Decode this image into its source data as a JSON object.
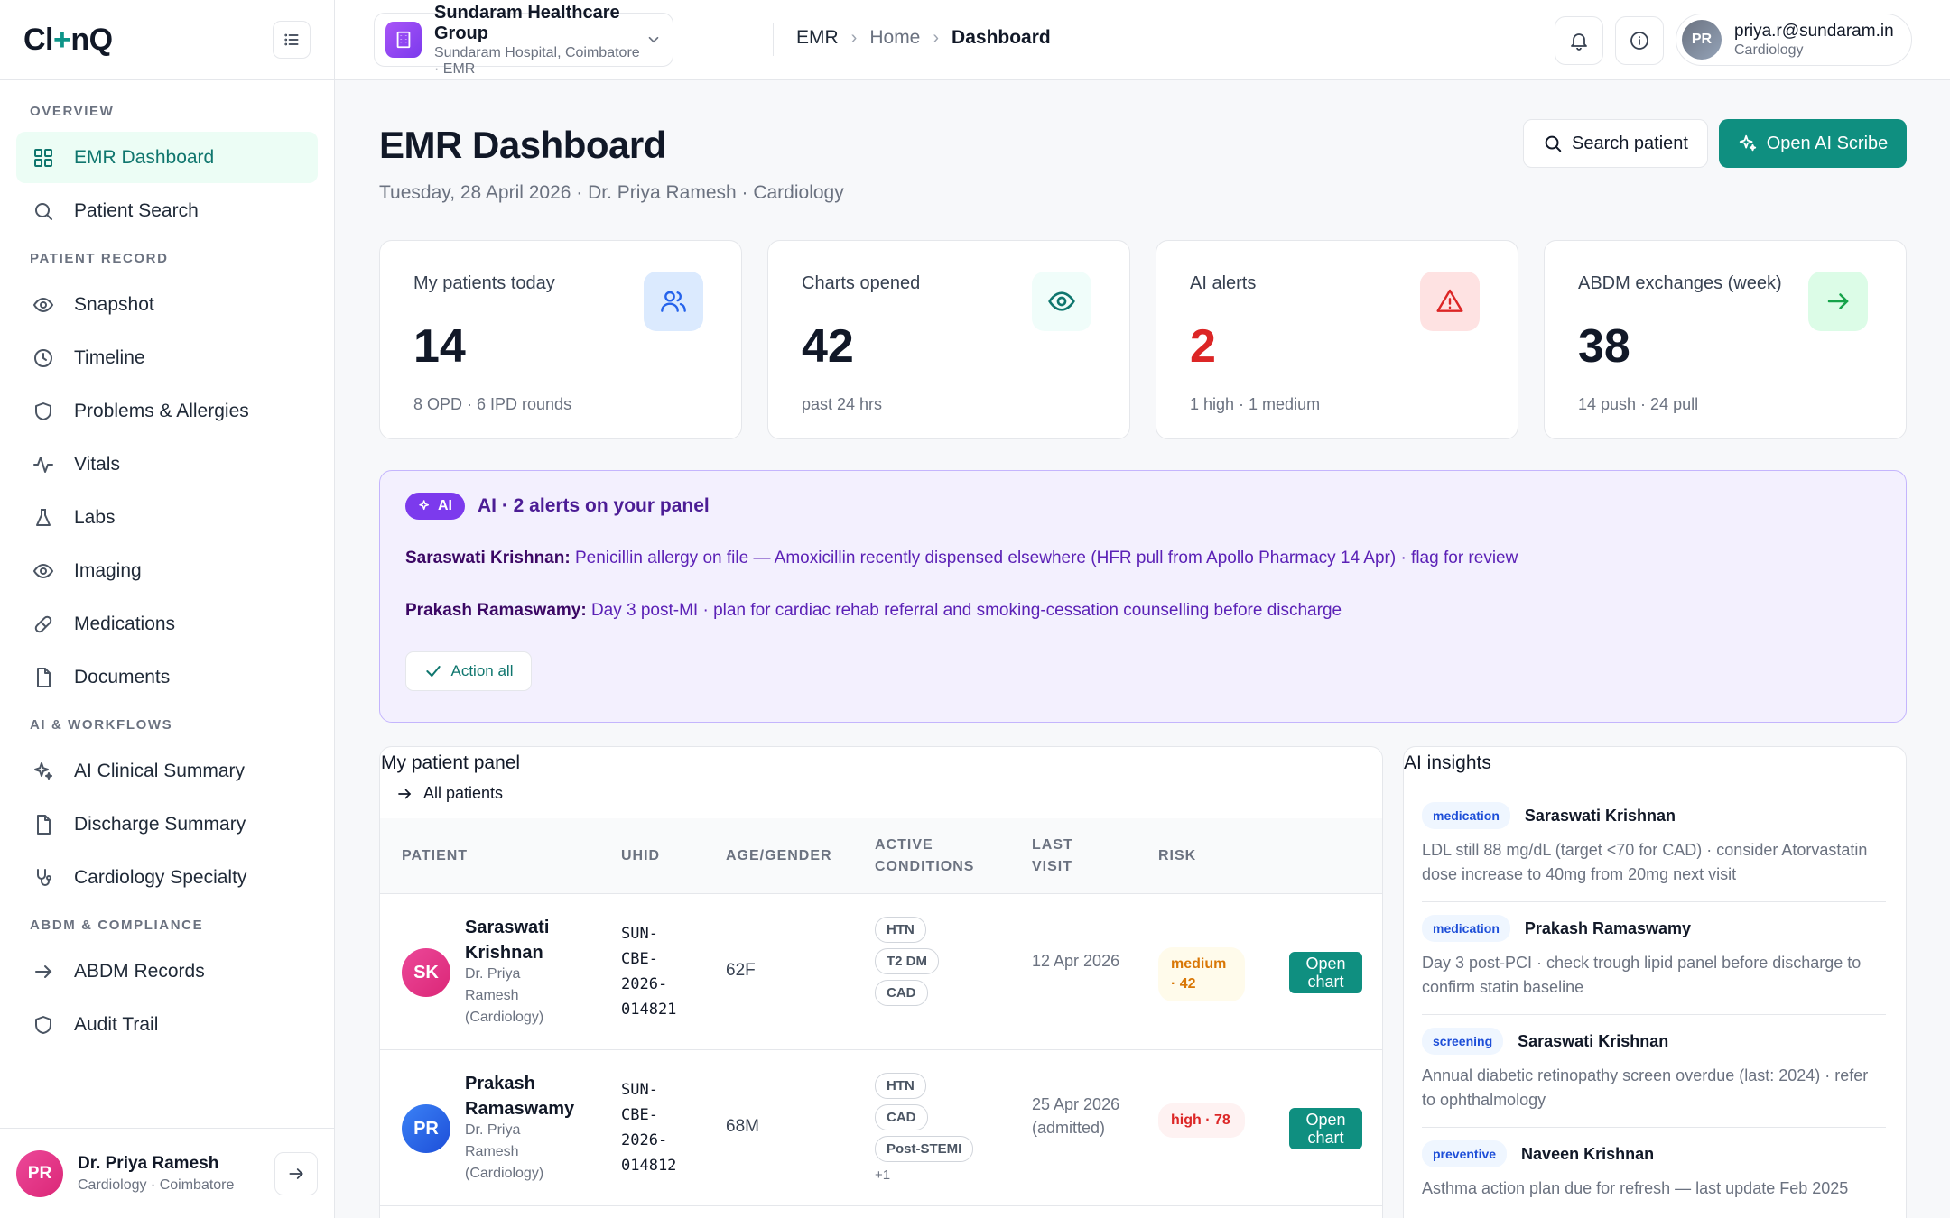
{
  "app": {
    "logo_a": "Cl",
    "logo_plus": "+",
    "logo_b": "nQ"
  },
  "sidebar": {
    "sections": [
      {
        "title": "OVERVIEW",
        "items": [
          {
            "label": "EMR Dashboard",
            "icon": "grid-icon",
            "active": true
          },
          {
            "label": "Patient Search",
            "icon": "search-icon"
          }
        ]
      },
      {
        "title": "PATIENT RECORD",
        "items": [
          {
            "label": "Snapshot",
            "icon": "eye-icon"
          },
          {
            "label": "Timeline",
            "icon": "clock-icon"
          },
          {
            "label": "Problems & Allergies",
            "icon": "shield-icon"
          },
          {
            "label": "Vitals",
            "icon": "activity-icon"
          },
          {
            "label": "Labs",
            "icon": "flask-icon"
          },
          {
            "label": "Imaging",
            "icon": "eye-icon"
          },
          {
            "label": "Medications",
            "icon": "pill-icon"
          },
          {
            "label": "Documents",
            "icon": "document-icon"
          }
        ]
      },
      {
        "title": "AI & WORKFLOWS",
        "items": [
          {
            "label": "AI Clinical Summary",
            "icon": "sparkles-icon"
          },
          {
            "label": "Discharge Summary",
            "icon": "document-icon"
          },
          {
            "label": "Cardiology Specialty",
            "icon": "stethoscope-icon"
          }
        ]
      },
      {
        "title": "ABDM & COMPLIANCE",
        "items": [
          {
            "label": "ABDM Records",
            "icon": "arrow-right-icon"
          },
          {
            "label": "Audit Trail",
            "icon": "shield-icon"
          }
        ]
      }
    ],
    "footer": {
      "initials": "PR",
      "name": "Dr. Priya Ramesh",
      "subtitle": "Cardiology · Coimbatore"
    }
  },
  "topbar": {
    "org_name": "Sundaram Healthcare Group",
    "org_sub": "Sundaram Hospital, Coimbatore · EMR",
    "breadcrumb": [
      "EMR",
      "Home",
      "Dashboard"
    ],
    "user_initials": "PR",
    "user_email": "priya.r@sundaram.in",
    "user_dept": "Cardiology"
  },
  "page": {
    "title": "EMR Dashboard",
    "subtitle": "Tuesday, 28 April 2026 · Dr. Priya Ramesh · Cardiology",
    "search_btn": "Search patient",
    "scribe_btn": "Open AI Scribe"
  },
  "stats": [
    {
      "label": "My patients today",
      "value": "14",
      "sub": "8 OPD · 6 IPD rounds",
      "icon": "users-icon",
      "color": "#2563eb"
    },
    {
      "label": "Charts opened",
      "value": "42",
      "sub": "past 24 hrs",
      "icon": "eye-icon",
      "color": "#0f766e"
    },
    {
      "label": "AI alerts",
      "value": "2",
      "sub": "1 high · 1 medium",
      "icon": "alert-triangle-icon",
      "color": "#dc2626"
    },
    {
      "label": "ABDM exchanges (week)",
      "value": "38",
      "sub": "14 push · 24 pull",
      "icon": "arrow-right-icon",
      "color": "#16a34a"
    }
  ],
  "ai_alerts": {
    "pill": "AI",
    "title": "AI · 2 alerts on your panel",
    "alerts": [
      {
        "patient": "Saraswati Krishnan:",
        "text": " Penicillin allergy on file — Amoxicillin recently dispensed elsewhere (HFR pull from Apollo Pharmacy 14 Apr) · flag for review"
      },
      {
        "patient": "Prakash Ramaswamy:",
        "text": " Day 3 post-MI · plan for cardiac rehab referral and smoking-cessation counselling before discharge"
      }
    ],
    "action_label": "Action all"
  },
  "panel": {
    "title": "My patient panel",
    "all_link": "All patients",
    "headers": {
      "patient": "PATIENT",
      "uhid": "UHID",
      "age": "AGE/GENDER",
      "cond1": "ACTIVE",
      "cond2": "CONDITIONS",
      "last1": "LAST",
      "last2": "VISIT",
      "risk": "RISK"
    },
    "rows": [
      {
        "initials": "SK",
        "name": "Saraswati Krishnan",
        "doctor": "Dr. Priya Ramesh (Cardiology)",
        "uhid": "SUN-CBE-2026-014821",
        "age_gender": "62F",
        "conditions": [
          "HTN",
          "T2 DM",
          "CAD"
        ],
        "more": "",
        "last_visit": "12 Apr 2026",
        "risk": "medium · 42",
        "risk_level": "medium",
        "open": "Open chart"
      },
      {
        "initials": "PR",
        "name": "Prakash Ramaswamy",
        "doctor": "Dr. Priya Ramesh (Cardiology)",
        "uhid": "SUN-CBE-2026-014812",
        "age_gender": "68M",
        "conditions": [
          "HTN",
          "CAD",
          "Post-STEMI"
        ],
        "more": "+1",
        "last_visit": "25 Apr 2026 (admitted)",
        "risk": "high · 78",
        "risk_level": "high",
        "open": "Open chart"
      }
    ]
  },
  "insights": {
    "title": "AI insights",
    "items": [
      {
        "tag": "medication",
        "patient": "Saraswati Krishnan",
        "text": "LDL still 88 mg/dL (target <70 for CAD) · consider Atorvastatin dose increase to 40mg from 20mg next visit"
      },
      {
        "tag": "medication",
        "patient": "Prakash Ramaswamy",
        "text": "Day 3 post-PCI · check trough lipid panel before discharge to confirm statin baseline"
      },
      {
        "tag": "screening",
        "patient": "Saraswati Krishnan",
        "text": "Annual diabetic retinopathy screen overdue (last: 2024) · refer to ophthalmology"
      },
      {
        "tag": "preventive",
        "patient": "Naveen Krishnan",
        "text": "Asthma action plan due for refresh — last update Feb 2025"
      }
    ]
  }
}
